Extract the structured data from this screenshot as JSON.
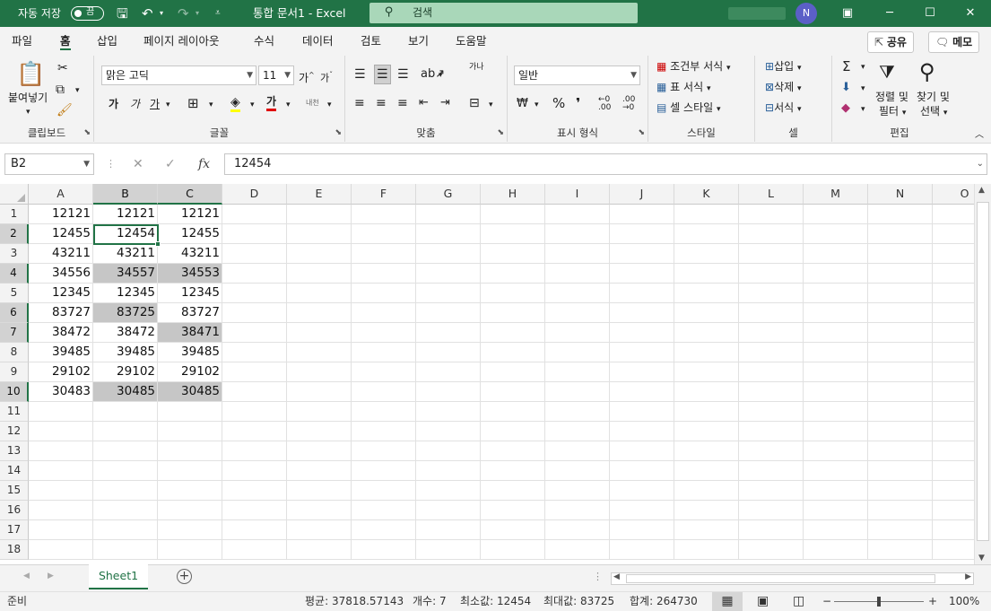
{
  "title_bar": {
    "autosave_label": "자동 저장",
    "autosave_state": "끔",
    "doc_title": "통합 문서1  -  Excel",
    "search_placeholder": "검색",
    "user_initial": "N"
  },
  "menu": {
    "tabs": [
      "파일",
      "홈",
      "삽입",
      "페이지 레이아웃",
      "수식",
      "데이터",
      "검토",
      "보기",
      "도움말"
    ],
    "active_tab": "홈",
    "share_label": "공유",
    "comment_label": "메모"
  },
  "ribbon": {
    "clipboard": {
      "paste": "붙여넣기",
      "label": "클립보드"
    },
    "font": {
      "name": "맑은 고딕",
      "size": "11",
      "label": "글꼴",
      "bold": "가",
      "italic": "가",
      "underline": "가",
      "font_color": "가",
      "grow": "가",
      "shrink": "가",
      "phonetic": "내천"
    },
    "alignment": {
      "label": "맞춤",
      "wrap": "가나"
    },
    "number": {
      "format": "일반",
      "label": "표시 형식"
    },
    "styles": {
      "conditional": "조건부 서식",
      "table": "표 서식",
      "cell": "셀 스타일",
      "label": "스타일"
    },
    "cells": {
      "insert": "삽입",
      "delete": "삭제",
      "format": "서식",
      "label": "셀"
    },
    "editing": {
      "sort": "정렬 및",
      "sort2": "필터",
      "find": "찾기 및",
      "find2": "선택",
      "label": "편집"
    }
  },
  "formula_bar": {
    "name_box": "B2",
    "formula": "12454"
  },
  "columns": [
    "A",
    "B",
    "C",
    "D",
    "E",
    "F",
    "G",
    "H",
    "I",
    "J",
    "K",
    "L",
    "M",
    "N",
    "O"
  ],
  "selected_columns": [
    "B",
    "C"
  ],
  "rows": [
    "1",
    "2",
    "3",
    "4",
    "5",
    "6",
    "7",
    "8",
    "9",
    "10",
    "11",
    "12",
    "13",
    "14",
    "15",
    "16",
    "17",
    "18"
  ],
  "selected_rows": [
    "2",
    "4",
    "6",
    "7",
    "10"
  ],
  "data": [
    [
      "12121",
      "12121",
      "12121"
    ],
    [
      "12455",
      "12454",
      "12455"
    ],
    [
      "43211",
      "43211",
      "43211"
    ],
    [
      "34556",
      "34557",
      "34553"
    ],
    [
      "12345",
      "12345",
      "12345"
    ],
    [
      "83727",
      "83725",
      "83727"
    ],
    [
      "38472",
      "38472",
      "38471"
    ],
    [
      "39485",
      "39485",
      "39485"
    ],
    [
      "29102",
      "29102",
      "29102"
    ],
    [
      "30483",
      "30485",
      "30485"
    ]
  ],
  "highlighted_cells": [
    "B4",
    "C4",
    "B6",
    "C7",
    "B10",
    "C10"
  ],
  "active_cell": "B2",
  "sheet_tab": "Sheet1",
  "status": {
    "ready": "준비",
    "average": "평균: 37818.57143",
    "count": "개수: 7",
    "min": "최소값: 12454",
    "max": "최대값: 83725",
    "sum": "합계: 264730",
    "zoom": "100%"
  },
  "colors": {
    "accent": "#217346",
    "highlight": "#c6c6c6",
    "header_selected": "#d2d2d2"
  }
}
